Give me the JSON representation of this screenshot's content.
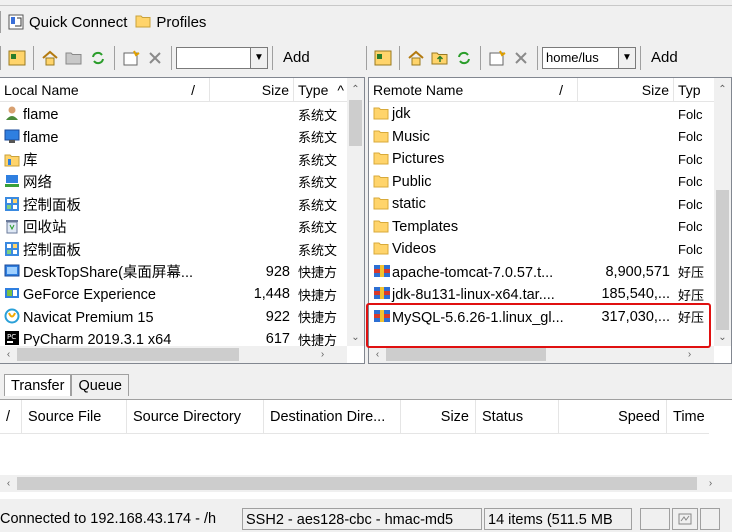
{
  "quick_connect": {
    "quick_connect_label": "Quick Connect",
    "profiles_label": "Profiles"
  },
  "local_toolbar": {
    "path_value": "",
    "add_label": "Add"
  },
  "remote_toolbar": {
    "path_value": "home/lus",
    "add_label": "Add"
  },
  "local": {
    "columns": {
      "name": "Local Name",
      "sort": "/",
      "size": "Size",
      "type": "Type",
      "sort_indicator": "^"
    },
    "rows": [
      {
        "name": "flame",
        "size": "",
        "type": "系统文",
        "icon": "user-icon"
      },
      {
        "name": "flame",
        "size": "",
        "type": "系统文",
        "icon": "monitor-icon"
      },
      {
        "name": "库",
        "size": "",
        "type": "系统文",
        "icon": "library-icon"
      },
      {
        "name": "网络",
        "size": "",
        "type": "系统文",
        "icon": "network-icon"
      },
      {
        "name": "控制面板",
        "size": "",
        "type": "系统文",
        "icon": "control-panel-icon"
      },
      {
        "name": "回收站",
        "size": "",
        "type": "系统文",
        "icon": "recycle-bin-icon"
      },
      {
        "name": "控制面板",
        "size": "",
        "type": "系统文",
        "icon": "control-panel-icon"
      },
      {
        "name": "DeskTopShare(桌面屏幕...",
        "size": "928",
        "type": "快捷方",
        "icon": "shortcut-app-icon"
      },
      {
        "name": "GeForce Experience",
        "size": "1,448",
        "type": "快捷方",
        "icon": "geforce-icon"
      },
      {
        "name": "Navicat Premium 15",
        "size": "922",
        "type": "快捷方",
        "icon": "navicat-icon"
      },
      {
        "name": "PyCharm 2019.3.1 x64",
        "size": "617",
        "type": "快捷方",
        "icon": "pycharm-icon"
      }
    ]
  },
  "remote": {
    "columns": {
      "name": "Remote Name",
      "sort": "/",
      "size": "Size",
      "type": "Typ",
      "sort_indicator": "^"
    },
    "rows": [
      {
        "name": "jdk",
        "size": "",
        "type": "Folc",
        "icon": "folder-icon"
      },
      {
        "name": "Music",
        "size": "",
        "type": "Folc",
        "icon": "folder-icon"
      },
      {
        "name": "Pictures",
        "size": "",
        "type": "Folc",
        "icon": "folder-icon"
      },
      {
        "name": "Public",
        "size": "",
        "type": "Folc",
        "icon": "folder-icon"
      },
      {
        "name": "static",
        "size": "",
        "type": "Folc",
        "icon": "folder-icon"
      },
      {
        "name": "Templates",
        "size": "",
        "type": "Folc",
        "icon": "folder-icon"
      },
      {
        "name": "Videos",
        "size": "",
        "type": "Folc",
        "icon": "folder-icon"
      },
      {
        "name": "apache-tomcat-7.0.57.t...",
        "size": "8,900,571",
        "type": "好压",
        "icon": "archive-icon"
      },
      {
        "name": "jdk-8u131-linux-x64.tar....",
        "size": "185,540,...",
        "type": "好压",
        "icon": "archive-icon"
      },
      {
        "name": "MySQL-5.6.26-1.linux_gl...",
        "size": "317,030,...",
        "type": "好压",
        "icon": "archive-icon"
      }
    ]
  },
  "transfer": {
    "tabs": [
      "Transfer",
      "Queue"
    ],
    "columns": [
      "/",
      "Source File",
      "Source Directory",
      "Destination Dire...",
      "Size",
      "Status",
      "Speed",
      "Time"
    ]
  },
  "status": {
    "connection": "Connected to 192.168.43.174 - /h",
    "cipher": "SSH2 - aes128-cbc - hmac-md5",
    "items": "14 items (511.5 MB"
  },
  "colors": {
    "highlight": "#e01010",
    "folder": "#ffd46b",
    "selection_frame": "#e01010"
  }
}
